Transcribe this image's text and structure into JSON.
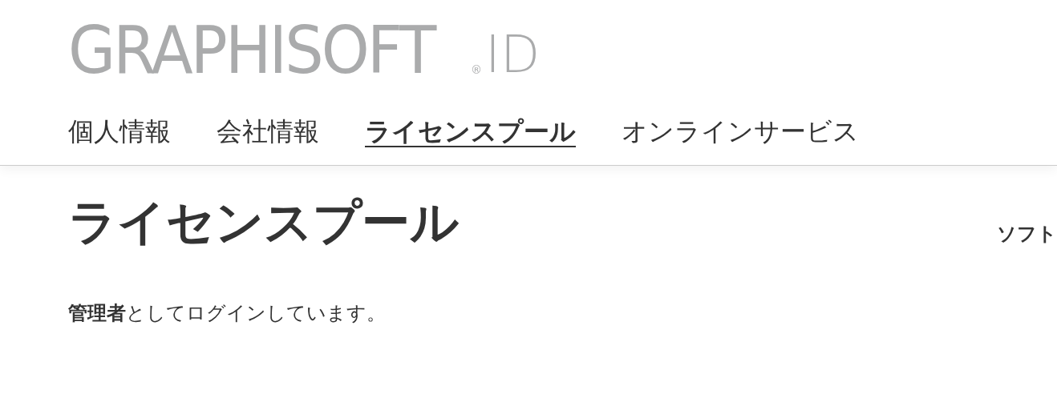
{
  "logo": {
    "brand": "GRAPHISOFT",
    "mark": "®",
    "suffix": "ID"
  },
  "nav": [
    {
      "label": "個人情報",
      "selected": false
    },
    {
      "label": "会社情報",
      "selected": false
    },
    {
      "label": "ライセンスプール",
      "selected": true
    },
    {
      "label": "オンラインサービス",
      "selected": false
    }
  ],
  "page": {
    "title": "ライセンスプール",
    "side_link": "ソフト"
  },
  "status": "**管理者**としてログインしています。"
}
